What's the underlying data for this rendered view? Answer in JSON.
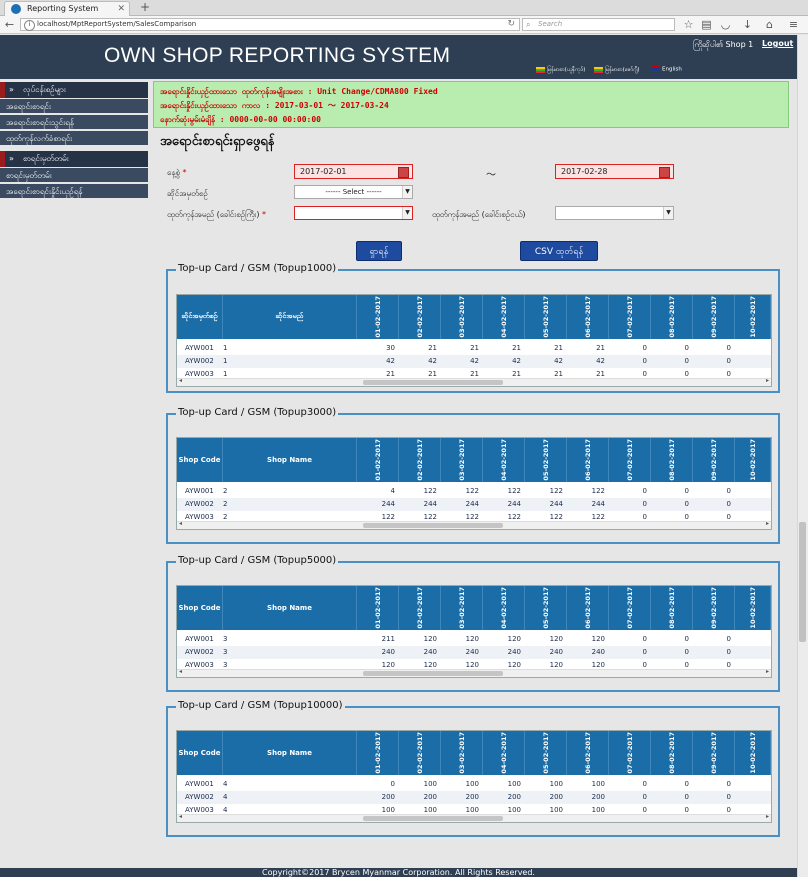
{
  "browser": {
    "tab_title": "Reporting System",
    "url": "localhost/MptReportSystem/SalesComparison",
    "search_placeholder": "Search"
  },
  "header": {
    "title": "OWN SHOP REPORTING SYSTEM",
    "user": "ကြိုဆိုပါ၏ Shop 1",
    "logout": "Logout",
    "languages": [
      "မြန်မာစာ(ယူနီကုဒ်)",
      "မြန်မာစာ(ဇော်ဂျီ)",
      "English"
    ]
  },
  "sidebar": {
    "groups": [
      {
        "title": "လုပ်ငန်းစဉ်များ",
        "items": [
          "အရောင်းစာရင်း",
          "အရောင်းစာရင်းသွင်းရန်",
          "ထုတ်ကုန်လက်ခံစာရင်း"
        ]
      },
      {
        "title": "စာရင်းမှတ်တမ်း",
        "items": [
          "စာရင်းမှတ်တမ်း",
          "အရောင်းစာရင်းနှိုင်းယှဉ်ရန်"
        ]
      }
    ]
  },
  "notice": {
    "line1": "အရောင်းနှိုင်းယှဉ်ထားသော ထုတ်ကုန်အမျိုးအစား : Unit Change/CDMA800 Fixed",
    "line2": "အရောင်းနှိုင်းယှဉ်ထားသော ကာလ : 2017-03-01 ～ 2017-03-24",
    "line3": "နောက်ဆုံးမွမ်းမံချိန် : 0000-00-00 00:00:00"
  },
  "form": {
    "heading": "အရောင်းစာရင်းရှာဖွေရန်",
    "date_label": "နေ့စွဲ",
    "date_from": "2017-02-01",
    "date_to": "2017-02-28",
    "tilde": "～",
    "shop_code_label": "ဆိုင်အမှတ်စဉ်",
    "shop_code_value": "------ Select ------",
    "product_type_label": "ထုတ်ကုန်အမည် (ခေါင်းစဉ်ကြီး)",
    "product_sub_label": "ထုတ်ကုန်အမည် (ခေါင်းစဉ်ငယ်)",
    "search_button": "ရှာရန်",
    "csv_button": "CSV ထုတ်ရန်"
  },
  "dates": [
    "01-02-2017",
    "02-02-2017",
    "03-02-2017",
    "04-02-2017",
    "05-02-2017",
    "06-02-2017",
    "07-02-2017",
    "08-02-2017",
    "09-02-2017",
    "10-02-2017"
  ],
  "panels": [
    {
      "title": "Top-up Card / GSM (Topup1000)",
      "col_shop_code": "ဆိုင်အမှတ်စဉ်",
      "col_shop_name": "ဆိုင်အမည်",
      "rows": [
        {
          "code": "AYW001",
          "name": "1",
          "values": [
            "30",
            "21",
            "21",
            "21",
            "21",
            "21",
            "0",
            "0",
            "0",
            ""
          ]
        },
        {
          "code": "AYW002",
          "name": "1",
          "values": [
            "42",
            "42",
            "42",
            "42",
            "42",
            "42",
            "0",
            "0",
            "0",
            ""
          ]
        },
        {
          "code": "AYW003",
          "name": "1",
          "values": [
            "21",
            "21",
            "21",
            "21",
            "21",
            "21",
            "0",
            "0",
            "0",
            ""
          ]
        }
      ]
    },
    {
      "title": "Top-up Card / GSM (Topup3000)",
      "col_shop_code": "Shop Code",
      "col_shop_name": "Shop Name",
      "rows": [
        {
          "code": "AYW001",
          "name": "2",
          "values": [
            "4",
            "122",
            "122",
            "122",
            "122",
            "122",
            "0",
            "0",
            "0",
            ""
          ]
        },
        {
          "code": "AYW002",
          "name": "2",
          "values": [
            "244",
            "244",
            "244",
            "244",
            "244",
            "244",
            "0",
            "0",
            "0",
            ""
          ]
        },
        {
          "code": "AYW003",
          "name": "2",
          "values": [
            "122",
            "122",
            "122",
            "122",
            "122",
            "122",
            "0",
            "0",
            "0",
            ""
          ]
        }
      ]
    },
    {
      "title": "Top-up Card / GSM (Topup5000)",
      "col_shop_code": "Shop Code",
      "col_shop_name": "Shop Name",
      "rows": [
        {
          "code": "AYW001",
          "name": "3",
          "values": [
            "211",
            "120",
            "120",
            "120",
            "120",
            "120",
            "0",
            "0",
            "0",
            ""
          ]
        },
        {
          "code": "AYW002",
          "name": "3",
          "values": [
            "240",
            "240",
            "240",
            "240",
            "240",
            "240",
            "0",
            "0",
            "0",
            ""
          ]
        },
        {
          "code": "AYW003",
          "name": "3",
          "values": [
            "120",
            "120",
            "120",
            "120",
            "120",
            "120",
            "0",
            "0",
            "0",
            ""
          ]
        }
      ]
    },
    {
      "title": "Top-up Card / GSM (Topup10000)",
      "col_shop_code": "Shop Code",
      "col_shop_name": "Shop Name",
      "rows": [
        {
          "code": "AYW001",
          "name": "4",
          "values": [
            "0",
            "100",
            "100",
            "100",
            "100",
            "100",
            "0",
            "0",
            "0",
            ""
          ]
        },
        {
          "code": "AYW002",
          "name": "4",
          "values": [
            "200",
            "200",
            "200",
            "200",
            "200",
            "200",
            "0",
            "0",
            "0",
            ""
          ]
        },
        {
          "code": "AYW003",
          "name": "4",
          "values": [
            "100",
            "100",
            "100",
            "100",
            "100",
            "100",
            "0",
            "0",
            "0",
            ""
          ]
        }
      ]
    }
  ],
  "footer": "Copyright©2017 Brycen Myanmar Corporation. All Rights Reserved."
}
